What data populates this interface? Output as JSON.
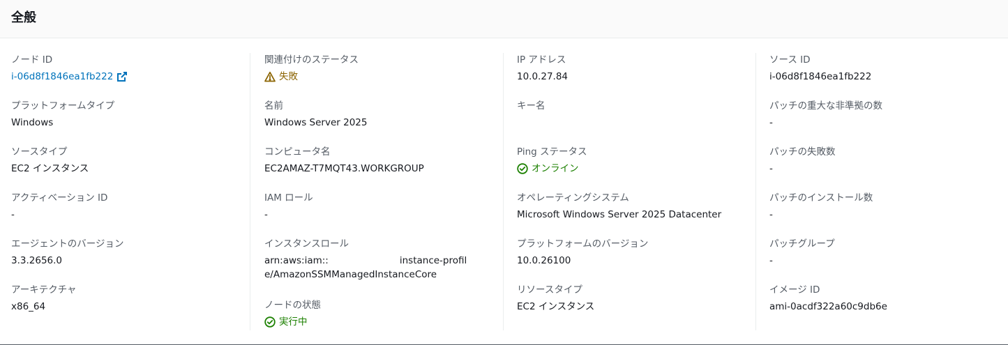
{
  "panel": {
    "title": "全般"
  },
  "columns": [
    [
      {
        "label": "ノード ID",
        "value": "i-06d8f1846ea1fb222",
        "kind": "link"
      },
      {
        "label": "プラットフォームタイプ",
        "value": "Windows"
      },
      {
        "label": "ソースタイプ",
        "value": "EC2 インスタンス"
      },
      {
        "label": "アクティベーション ID",
        "value": "-"
      },
      {
        "label": "エージェントのバージョン",
        "value": "3.3.2656.0"
      },
      {
        "label": "アーキテクチャ",
        "value": "x86_64"
      }
    ],
    [
      {
        "label": "関連付けのステータス",
        "value": "失敗",
        "kind": "warning"
      },
      {
        "label": "名前",
        "value": "Windows Server 2025"
      },
      {
        "label": "コンピュータ名",
        "value": "EC2AMAZ-T7MQT43.WORKGROUP"
      },
      {
        "label": "IAM ロール",
        "value": "-"
      },
      {
        "label": "インスタンスロール",
        "value_prefix": "arn:aws:iam::",
        "value_suffix": "instance-profile/AmazonSSMManagedInstanceCore",
        "kind": "redacted"
      },
      {
        "label": "ノードの状態",
        "value": "実行中",
        "kind": "success"
      }
    ],
    [
      {
        "label": "IP アドレス",
        "value": "10.0.27.84"
      },
      {
        "label": "キー名",
        "value": ""
      },
      {
        "label": "Ping ステータス",
        "value": "オンライン",
        "kind": "success"
      },
      {
        "label": "オペレーティングシステム",
        "value": "Microsoft Windows Server 2025 Datacenter"
      },
      {
        "label": "プラットフォームのバージョン",
        "value": "10.0.26100"
      },
      {
        "label": "リソースタイプ",
        "value": "EC2 インスタンス"
      }
    ],
    [
      {
        "label": "ソース ID",
        "value": "i-06d8f1846ea1fb222"
      },
      {
        "label": "パッチの重大な非準拠の数",
        "value": "-"
      },
      {
        "label": "パッチの失敗数",
        "value": "-"
      },
      {
        "label": "パッチのインストール数",
        "value": "-"
      },
      {
        "label": "パッチグループ",
        "value": "-"
      },
      {
        "label": "イメージ ID",
        "value": "ami-0acdf322a60c9db6e"
      }
    ]
  ],
  "icons": {
    "external_link": "external-link-icon",
    "warning": "warning-icon",
    "success": "status-positive-icon"
  },
  "colors": {
    "link": "#0073bb",
    "warning": "#8d6605",
    "success": "#1d8102",
    "label": "#545b64",
    "text": "#16191f"
  }
}
